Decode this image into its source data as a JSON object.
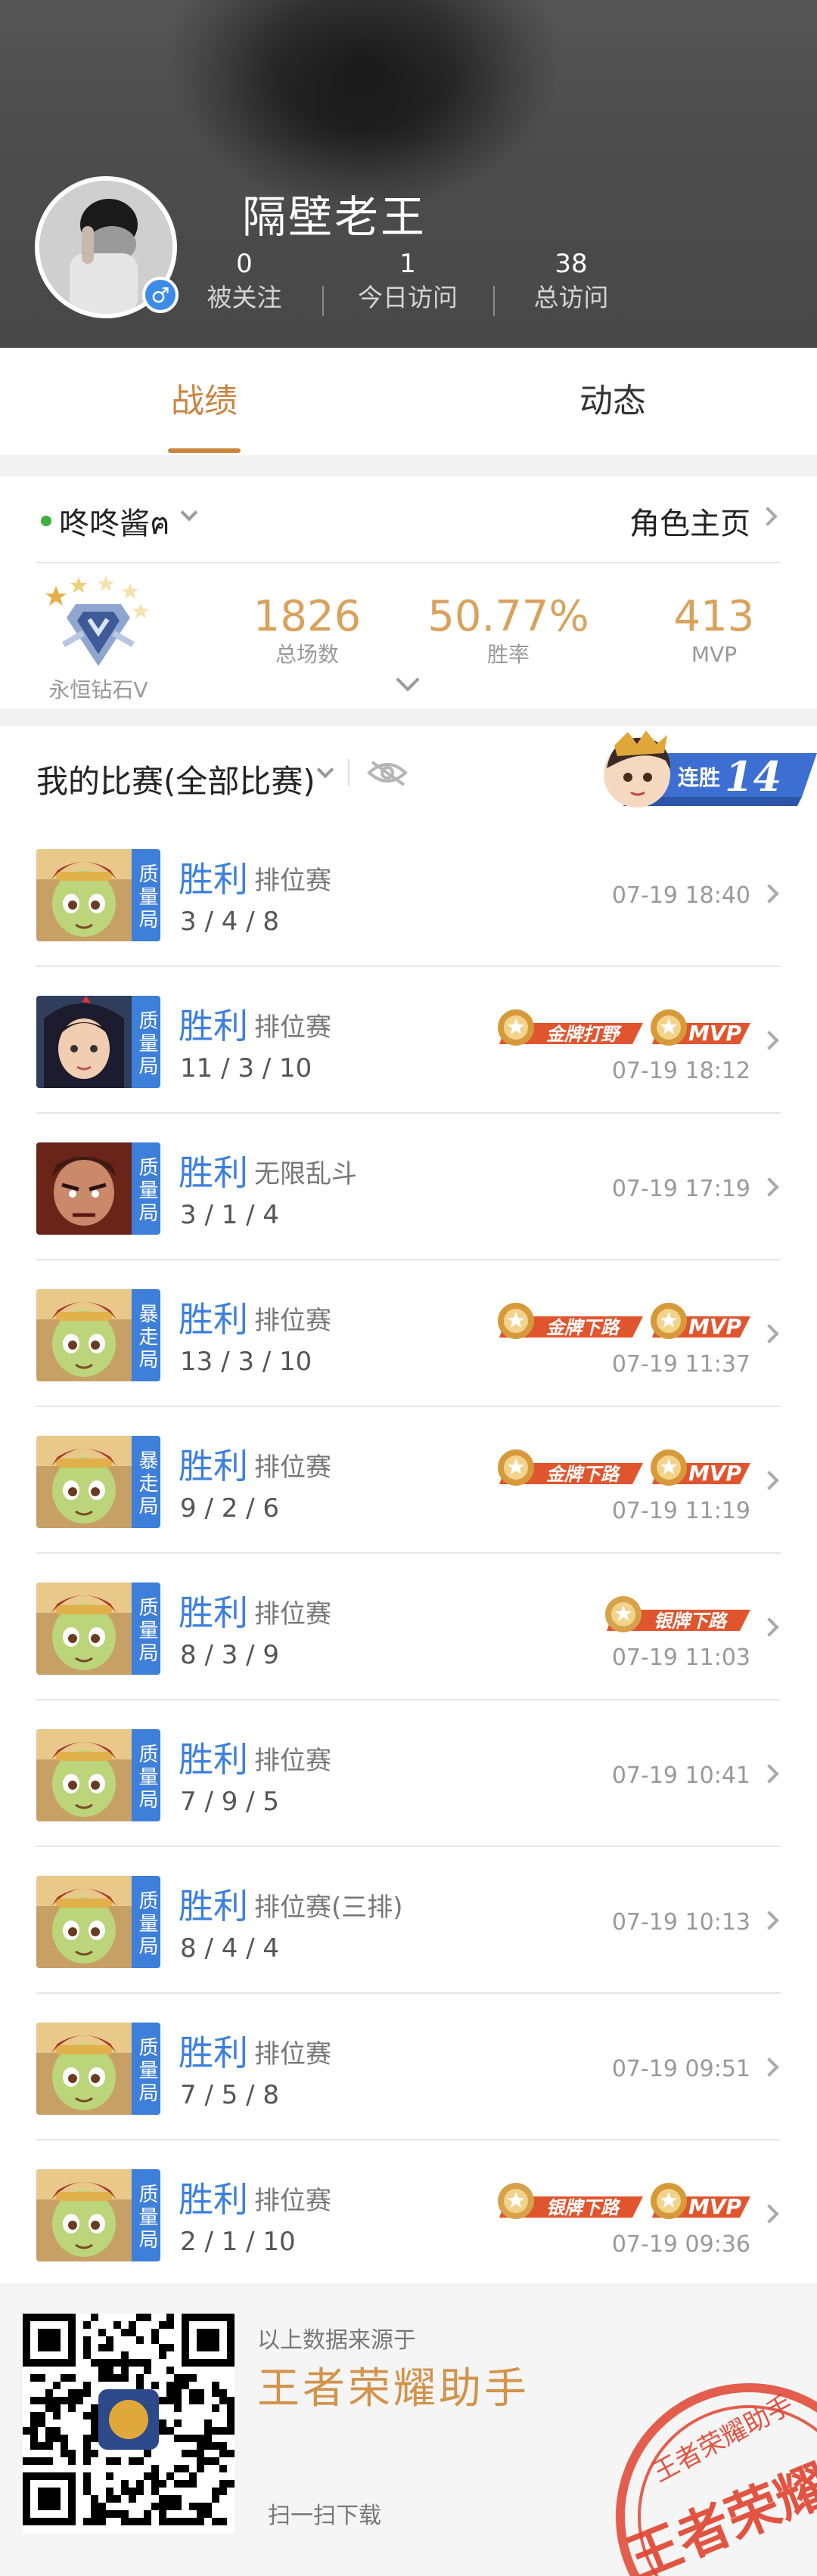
{
  "profile": {
    "username": "隔壁老王",
    "gender_icon": "♂",
    "stats": [
      {
        "value": "0",
        "label": "被关注"
      },
      {
        "value": "1",
        "label": "今日访问"
      },
      {
        "value": "38",
        "label": "总访问"
      }
    ]
  },
  "tabs": [
    {
      "label": "战绩",
      "active": true
    },
    {
      "label": "动态",
      "active": false
    }
  ],
  "role": {
    "name": "咚咚酱ฅ",
    "page_link": "角色主页",
    "rank": "永恒钻石V",
    "summary": [
      {
        "value": "1826",
        "label": "总场数"
      },
      {
        "value": "50.77%",
        "label": "胜率"
      },
      {
        "value": "413",
        "label": "MVP"
      }
    ]
  },
  "matches_header": {
    "title": "我的比赛(全部比赛)",
    "streak_label": "连胜",
    "streak_count": "14"
  },
  "badges": {
    "gold_jungle": "金牌打野",
    "gold_lane": "金牌下路",
    "silver_lane": "银牌下路",
    "mvp": "MVP"
  },
  "matches": [
    {
      "tag": "质量局",
      "result": "胜利",
      "mode": "排位赛",
      "kda": "3 / 4 / 8",
      "time": "07-19 18:40",
      "badges": []
    },
    {
      "tag": "质量局",
      "result": "胜利",
      "mode": "排位赛",
      "kda": "11 / 3 / 10",
      "time": "07-19 18:12",
      "badges": [
        "金牌打野",
        "MVP"
      ]
    },
    {
      "tag": "质量局",
      "result": "胜利",
      "mode": "无限乱斗",
      "kda": "3 / 1 / 4",
      "time": "07-19 17:19",
      "badges": []
    },
    {
      "tag": "暴走局",
      "result": "胜利",
      "mode": "排位赛",
      "kda": "13 / 3 / 10",
      "time": "07-19 11:37",
      "badges": [
        "金牌下路",
        "MVP"
      ]
    },
    {
      "tag": "暴走局",
      "result": "胜利",
      "mode": "排位赛",
      "kda": "9 / 2 / 6",
      "time": "07-19 11:19",
      "badges": [
        "金牌下路",
        "MVP"
      ]
    },
    {
      "tag": "质量局",
      "result": "胜利",
      "mode": "排位赛",
      "kda": "8 / 3 / 9",
      "time": "07-19 11:03",
      "badges": [
        "银牌下路"
      ]
    },
    {
      "tag": "质量局",
      "result": "胜利",
      "mode": "排位赛",
      "kda": "7 / 9 / 5",
      "time": "07-19 10:41",
      "badges": []
    },
    {
      "tag": "质量局",
      "result": "胜利",
      "mode": "排位赛(三排)",
      "kda": "8 / 4 / 4",
      "time": "07-19 10:13",
      "badges": []
    },
    {
      "tag": "质量局",
      "result": "胜利",
      "mode": "排位赛",
      "kda": "7 / 5 / 8",
      "time": "07-19 09:51",
      "badges": []
    },
    {
      "tag": "质量局",
      "result": "胜利",
      "mode": "排位赛",
      "kda": "2 / 1 / 10",
      "time": "07-19 09:36",
      "badges": [
        "银牌下路",
        "MVP"
      ]
    }
  ],
  "footer": {
    "source_text": "以上数据来源于",
    "app_name": "王者荣耀助手",
    "scan_text": "扫一扫下载",
    "stamp_top": "王者荣耀助手",
    "stamp_main": "王者荣耀"
  },
  "colors": {
    "accent_gold": "#c9853f",
    "stat_gold": "#d9a25c",
    "win_blue": "#3b7fe0",
    "tag_blue": "#3e7fd9",
    "badge_orange": "#e0552e",
    "badge_gold": "#d79a3a",
    "stamp_red": "#e0432f"
  }
}
